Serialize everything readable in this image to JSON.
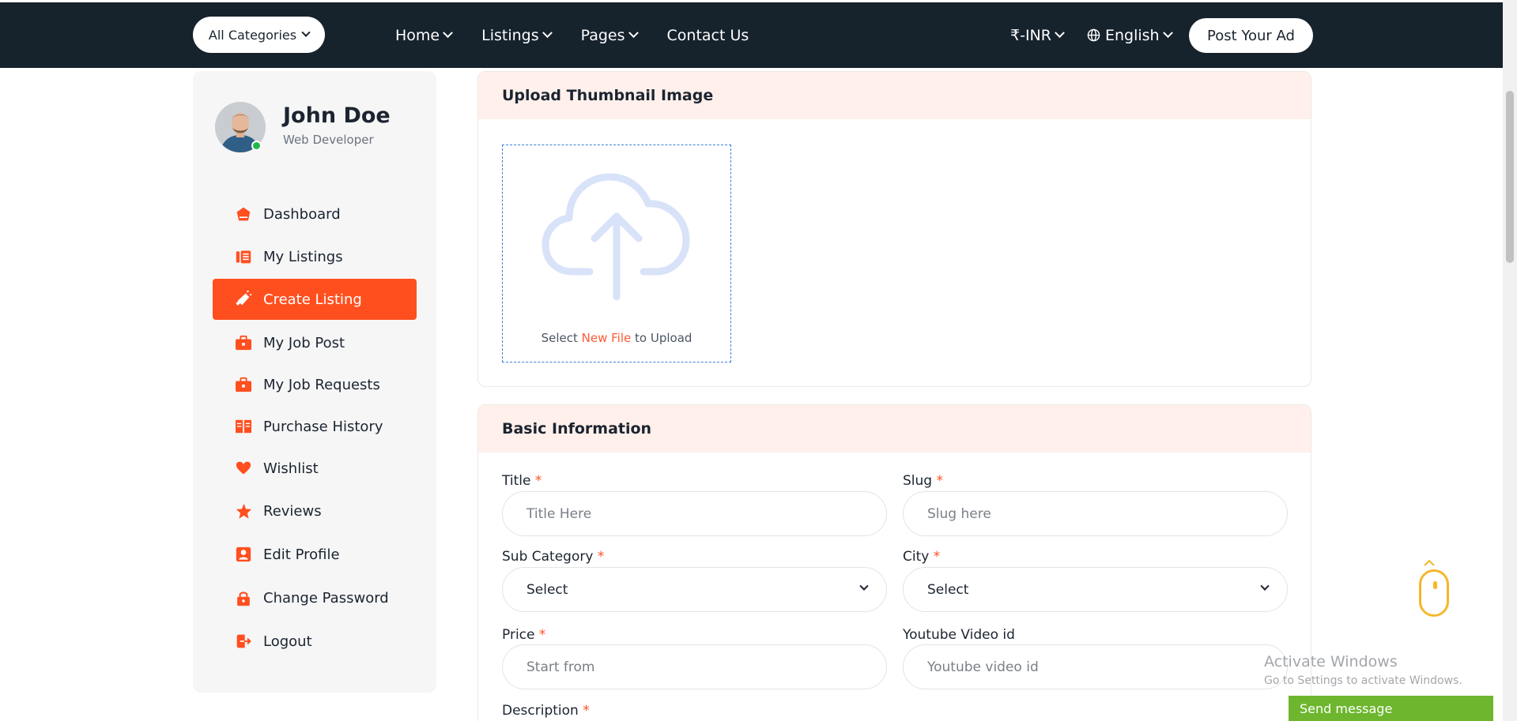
{
  "header": {
    "all_categories": "All Categories",
    "nav": [
      {
        "label": "Home"
      },
      {
        "label": "Listings"
      },
      {
        "label": "Pages"
      },
      {
        "label": "Contact Us"
      }
    ],
    "currency": "₹-INR",
    "language": "English",
    "post_ad": "Post Your Ad"
  },
  "profile": {
    "name": "John Doe",
    "role": "Web Developer",
    "status_color": "#20b84a"
  },
  "sidebar": {
    "items": [
      {
        "label": "Dashboard",
        "icon": "house-icon"
      },
      {
        "label": "My Listings",
        "icon": "listing-icon"
      },
      {
        "label": "Create Listing",
        "icon": "megaphone-icon",
        "active": true
      },
      {
        "label": "My Job Post",
        "icon": "briefcase-icon"
      },
      {
        "label": "My Job Requests",
        "icon": "briefcase-icon"
      },
      {
        "label": "Purchase History",
        "icon": "book-icon"
      },
      {
        "label": "Wishlist",
        "icon": "heart-icon"
      },
      {
        "label": "Reviews",
        "icon": "star-icon"
      },
      {
        "label": "Edit Profile",
        "icon": "user-card-icon"
      },
      {
        "label": "Change Password",
        "icon": "lock-icon"
      },
      {
        "label": "Logout",
        "icon": "logout-icon"
      }
    ],
    "accent_color": "#ff4f1f"
  },
  "thumbnail": {
    "title": "Upload Thumbnail Image",
    "select": "Select",
    "new_file": "New File",
    "to_upload": "to Upload"
  },
  "basic_info": {
    "title": "Basic Information",
    "title_label": "Title",
    "title_placeholder": "Title Here",
    "slug_label": "Slug",
    "slug_placeholder": "Slug here",
    "subcategory_label": "Sub Category",
    "subcategory_value": "Select",
    "city_label": "City",
    "city_value": "Select",
    "price_label": "Price",
    "price_placeholder": "Start from",
    "youtube_label": "Youtube Video id",
    "youtube_placeholder": "Youtube video id",
    "description_label": "Description",
    "required_mark": "*"
  },
  "overlay": {
    "activate_title": "Activate Windows",
    "activate_sub": "Go to Settings to activate Windows.",
    "send_message": "Send message"
  }
}
